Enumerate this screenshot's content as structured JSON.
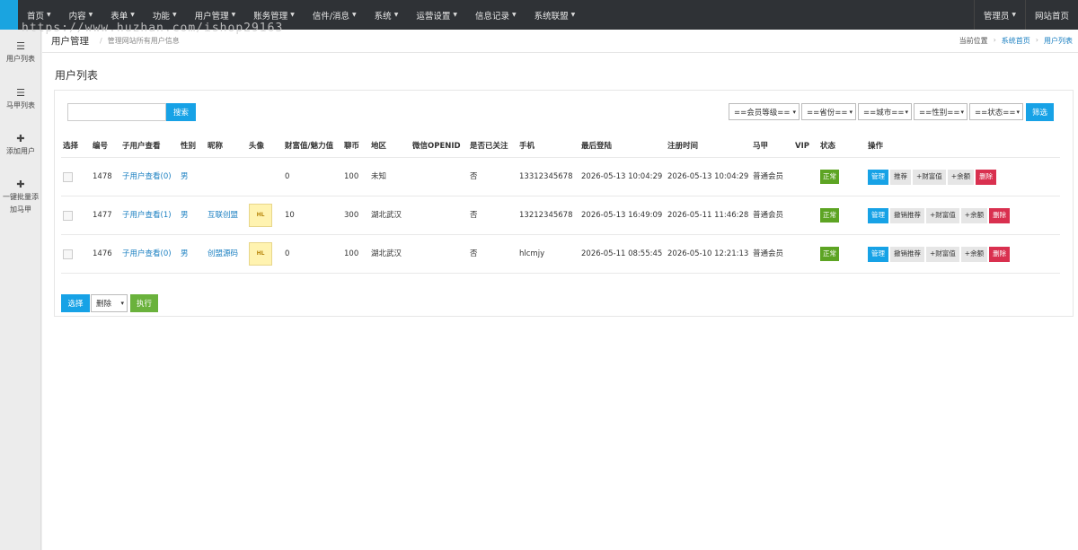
{
  "nav": {
    "items": [
      "首页",
      "内容",
      "表单",
      "功能",
      "用户管理",
      "账务管理",
      "信件/消息",
      "系统",
      "运营设置",
      "信息记录",
      "系统联盟"
    ],
    "admin": "管理员",
    "home": "网站首页"
  },
  "watermark": "https://www.huzhan.com/ishop29163",
  "sidebar": {
    "items": [
      {
        "icon": "list-icon",
        "label": "用户列表"
      },
      {
        "icon": "list-icon",
        "label": "马甲列表"
      },
      {
        "icon": "plus-icon",
        "label": "添加用户"
      },
      {
        "icon": "plus-icon",
        "label": "一键批量添加马甲"
      }
    ]
  },
  "crumb": {
    "title": "用户管理",
    "sep": "/",
    "desc": "管理网站所有用户信息",
    "position_label": "当前位置",
    "path": [
      "系统首页",
      "用户列表"
    ]
  },
  "page_heading": "用户列表",
  "toolbar": {
    "search_label": "搜索",
    "filter_label": "筛选",
    "selects": [
      "==会员等级==",
      "==省份==",
      "==城市==",
      "==性别==",
      "==状态=="
    ]
  },
  "table": {
    "headers": [
      "选择",
      "编号",
      "子用户查看",
      "性别",
      "昵称",
      "头像",
      "财富值/魅力值",
      "聊币",
      "地区",
      "微信OPENID",
      "是否已关注",
      "手机",
      "最后登陆",
      "注册时间",
      "马甲",
      "VIP",
      "状态",
      "操作"
    ],
    "rows": [
      {
        "id": "1478",
        "sub": "子用户查看(0)",
        "gender": "男",
        "nick": "",
        "avatar": "",
        "wealth": "0",
        "coins": "100",
        "region": "未知",
        "openid": "",
        "followed": "否",
        "phone": "13312345678",
        "last_login": "2026-05-13 10:04:29",
        "reg_time": "2026-05-13 10:04:29",
        "vest": "普通会员",
        "vip": "",
        "status": "正常",
        "ops": [
          "管理",
          "推荐",
          "+财富值",
          "+余额",
          "删除"
        ]
      },
      {
        "id": "1477",
        "sub": "子用户查看(1)",
        "gender": "男",
        "nick": "互联创盟",
        "avatar": "HL",
        "wealth": "10",
        "coins": "300",
        "region": "湖北武汉",
        "openid": "",
        "followed": "否",
        "phone": "13212345678",
        "last_login": "2026-05-13 16:49:09",
        "reg_time": "2026-05-11 11:46:28",
        "vest": "普通会员",
        "vip": "",
        "status": "正常",
        "ops": [
          "管理",
          "撤销推荐",
          "+财富值",
          "+余额",
          "删除"
        ]
      },
      {
        "id": "1476",
        "sub": "子用户查看(0)",
        "gender": "男",
        "nick": "创盟源码",
        "avatar": "HL",
        "wealth": "0",
        "coins": "100",
        "region": "湖北武汉",
        "openid": "",
        "followed": "否",
        "phone": "hlcmjy",
        "last_login": "2026-05-11 08:55:45",
        "reg_time": "2026-05-10 12:21:13",
        "vest": "普通会员",
        "vip": "",
        "status": "正常",
        "ops": [
          "管理",
          "撤销推荐",
          "+财富值",
          "+余额",
          "删除"
        ]
      }
    ]
  },
  "bottom": {
    "select_label": "选择",
    "action_value": "删除",
    "execute_label": "执行"
  }
}
